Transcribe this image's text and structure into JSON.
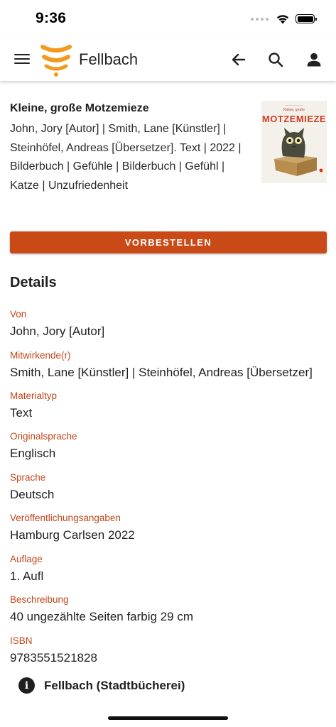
{
  "status_bar": {
    "time": "9:36"
  },
  "app_bar": {
    "title": "Fellbach"
  },
  "book": {
    "title": "Kleine, große Motzemieze",
    "info": "John, Jory [Autor] | Smith, Lane [Künstler] | Steinhöfel, Andreas [Übersetzer]. Text | 2022 | Bilderbuch | Gefühle | Bilderbuch | Gefühl | Katze | Unzufriedenheit",
    "cover": {
      "title": "MOTZEMIEZE",
      "subtitle": "Kleine, große"
    }
  },
  "actions": {
    "reserve_label": "VORBESTELLEN"
  },
  "details": {
    "heading": "Details",
    "fields": [
      {
        "label": "Von",
        "value": "John, Jory [Autor]"
      },
      {
        "label": "Mitwirkende(r)",
        "value": "Smith, Lane [Künstler] | Steinhöfel, Andreas [Übersetzer]"
      },
      {
        "label": "Materialtyp",
        "value": "Text"
      },
      {
        "label": "Originalsprache",
        "value": "Englisch"
      },
      {
        "label": "Sprache",
        "value": "Deutsch"
      },
      {
        "label": "Veröffentlichungsangaben",
        "value": "Hamburg Carlsen 2022"
      },
      {
        "label": "Auflage",
        "value": "1. Aufl"
      },
      {
        "label": "Beschreibung",
        "value": "40 ungezählte Seiten farbig 29 cm"
      },
      {
        "label": "ISBN",
        "value": "9783551521828"
      }
    ]
  },
  "library": {
    "name": "Fellbach (Stadtbücherei)",
    "icon": "info-icon"
  },
  "colors": {
    "accent": "#c94a17",
    "label": "#c0471b",
    "logo": "#f39a1d"
  }
}
